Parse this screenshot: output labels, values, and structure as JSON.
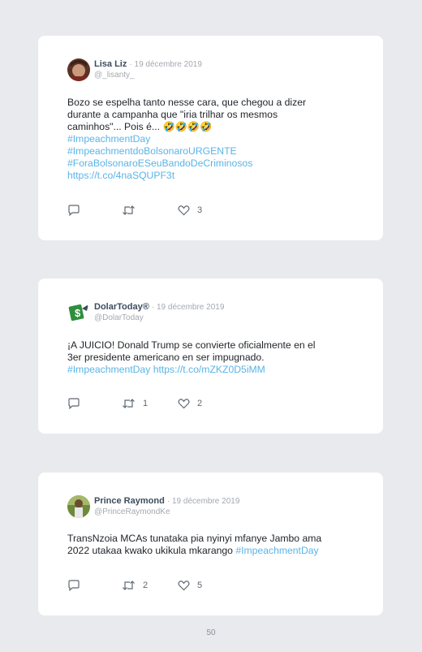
{
  "tweets": [
    {
      "name": "Lisa Liz",
      "date": "19 décembre 2019",
      "handle": "@_lisanty_",
      "lines": [
        {
          "text": "Bozo se espelha tanto nesse cara, que chegou a dizer",
          "link": false
        },
        {
          "text": "durante a campanha que \"iria trilhar os mesmos",
          "link": false
        },
        {
          "text": "caminhos\"... Pois é... 🤣🤣🤣🤣",
          "link": false
        },
        {
          "text": "#ImpeachmentDay",
          "link": true
        },
        {
          "text": "#ImpeachmentdoBolsonaroURGENTE",
          "link": true
        },
        {
          "text": "#ForaBolsonaroESeuBandoDeCriminosos",
          "link": true
        },
        {
          "text": "https://t.co/4naSQUPF3t",
          "link": true
        }
      ],
      "retweets": "",
      "likes": "3"
    },
    {
      "name": "DolarToday®",
      "date": "19 décembre 2019",
      "handle": "@DolarToday",
      "lines_a": "¡A JUICIO! Donald Trump se convierte oficialmente en el",
      "lines_b": "3er presidente americano en ser impugnado.",
      "hashtag": "#ImpeachmentDay",
      "url": "https://t.co/mZKZ0D5iMM",
      "retweets": "1",
      "likes": "2"
    },
    {
      "name": "Prince Raymond",
      "date": "19 décembre 2019",
      "handle": "@PrinceRaymondKe",
      "line_a": "TransNzoia MCAs tunataka pia nyinyi mfanye Jambo ama",
      "line_b": "2022 utakaa kwako ukikula mkarango",
      "hashtag": "#ImpeachmentDay",
      "retweets": "2",
      "likes": "5"
    }
  ],
  "page_number": "50",
  "colors": {
    "link": "#5ab4e6",
    "name": "#3d4c5e",
    "muted": "#a3a9b1",
    "background": "#e9eaee"
  },
  "icons": [
    "reply-icon",
    "retweet-icon",
    "like-icon"
  ]
}
